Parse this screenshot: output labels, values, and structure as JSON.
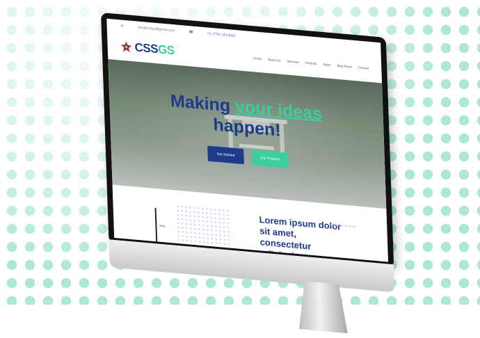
{
  "topbar": {
    "email": "info@cssgs@gmail.com",
    "phone": "+1 (774) 123 4562"
  },
  "logo": {
    "text_main": "CSS",
    "text_accent": "GS"
  },
  "nav": {
    "items": [
      "Home",
      "About Us",
      "Services",
      "Portfolio",
      "Team",
      "Blog Posts",
      "Contact"
    ]
  },
  "hero": {
    "title_line1_prefix": "Making ",
    "title_line1_accent": "your ideas",
    "title_line2": "happen!",
    "primary_button": "Get Started",
    "secondary_button": "Our Projects"
  },
  "section": {
    "heading": "Lorem ipsum dolor sit amet, consectetur adipiscing",
    "faint_text": "Lorem ipsum dolor",
    "tag": "Blog"
  },
  "colors": {
    "brand_navy": "#1e3a8a",
    "brand_mint": "#3ccf9e",
    "dot_color": "#a8e6d6"
  }
}
